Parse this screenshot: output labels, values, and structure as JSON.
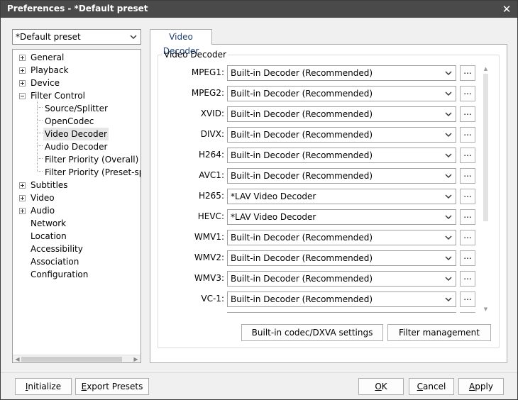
{
  "window": {
    "title": "Preferences - *Default preset",
    "close_icon": "close-icon"
  },
  "preset": {
    "selected": "*Default preset"
  },
  "tree": {
    "items": [
      {
        "label": "General",
        "expander": "plus"
      },
      {
        "label": "Playback",
        "expander": "plus"
      },
      {
        "label": "Device",
        "expander": "plus"
      },
      {
        "label": "Filter Control",
        "expander": "minus"
      },
      {
        "label": "Source/Splitter"
      },
      {
        "label": "OpenCodec"
      },
      {
        "label": "Video Decoder",
        "selected": true
      },
      {
        "label": "Audio Decoder"
      },
      {
        "label": "Filter Priority (Overall)"
      },
      {
        "label": "Filter Priority (Preset-spec"
      },
      {
        "label": "Subtitles",
        "expander": "plus"
      },
      {
        "label": "Video",
        "expander": "plus"
      },
      {
        "label": "Audio",
        "expander": "plus"
      },
      {
        "label": "Network"
      },
      {
        "label": "Location"
      },
      {
        "label": "Accessibility"
      },
      {
        "label": "Association"
      },
      {
        "label": "Configuration"
      }
    ]
  },
  "tab": {
    "label": "Video Decoder"
  },
  "group": {
    "title": "Video Decoder"
  },
  "decoders": [
    {
      "label": "MPEG1:",
      "value": "Built-in Decoder (Recommended)",
      "more": "..."
    },
    {
      "label": "MPEG2:",
      "value": "Built-in Decoder (Recommended)",
      "more": "..."
    },
    {
      "label": "XVID:",
      "value": "Built-in Decoder (Recommended)",
      "more": "..."
    },
    {
      "label": "DIVX:",
      "value": "Built-in Decoder (Recommended)",
      "more": "..."
    },
    {
      "label": "H264:",
      "value": "Built-in Decoder (Recommended)",
      "more": "..."
    },
    {
      "label": "AVC1:",
      "value": "Built-in Decoder (Recommended)",
      "more": "..."
    },
    {
      "label": "H265:",
      "value": "*LAV Video Decoder",
      "more": "..."
    },
    {
      "label": "HEVC:",
      "value": "*LAV Video Decoder",
      "more": "..."
    },
    {
      "label": "WMV1:",
      "value": "Built-in Decoder (Recommended)",
      "more": "..."
    },
    {
      "label": "WMV2:",
      "value": "Built-in Decoder (Recommended)",
      "more": "..."
    },
    {
      "label": "WMV3:",
      "value": "Built-in Decoder (Recommended)",
      "more": "..."
    },
    {
      "label": "VC-1:",
      "value": "Built-in Decoder (Recommended)",
      "more": "..."
    },
    {
      "label": "",
      "value": "",
      "more": ""
    }
  ],
  "buttons": {
    "codec_settings": "Built-in codec/DXVA settings",
    "filter_management": "Filter management",
    "initialize_pre": "I",
    "initialize_rest": "nitialize",
    "export_pre": "E",
    "export_rest": "xport Presets",
    "ok_pre": "O",
    "ok_rest": "K",
    "cancel_pre": "C",
    "cancel_rest": "ancel",
    "apply_pre": "A",
    "apply_rest": "pply"
  }
}
